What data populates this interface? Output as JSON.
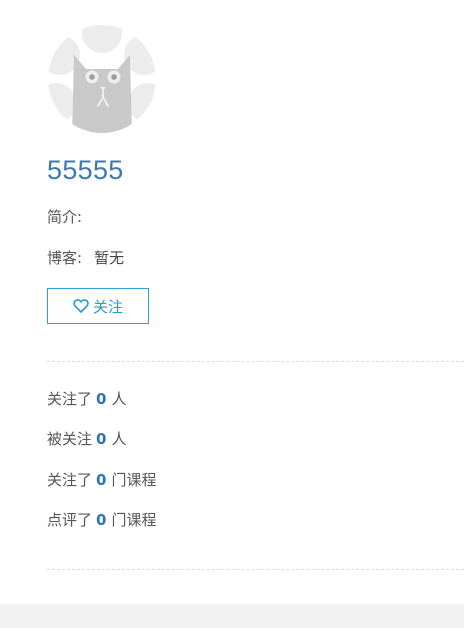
{
  "profile": {
    "username": "55555",
    "intro_label": "简介:",
    "intro_value": "",
    "blog_label": "博客:",
    "blog_value": "暂无",
    "follow_button_label": "关注",
    "follow_button_icon": "heart-outline-icon",
    "accent_color": "#2ba3cc"
  },
  "stats": [
    {
      "prefix": "关注了",
      "count": "0",
      "suffix": "人"
    },
    {
      "prefix": "被关注",
      "count": "0",
      "suffix": "人"
    },
    {
      "prefix": "关注了",
      "count": "0",
      "suffix": "门课程"
    },
    {
      "prefix": "点评了",
      "count": "0",
      "suffix": "门课程"
    }
  ]
}
